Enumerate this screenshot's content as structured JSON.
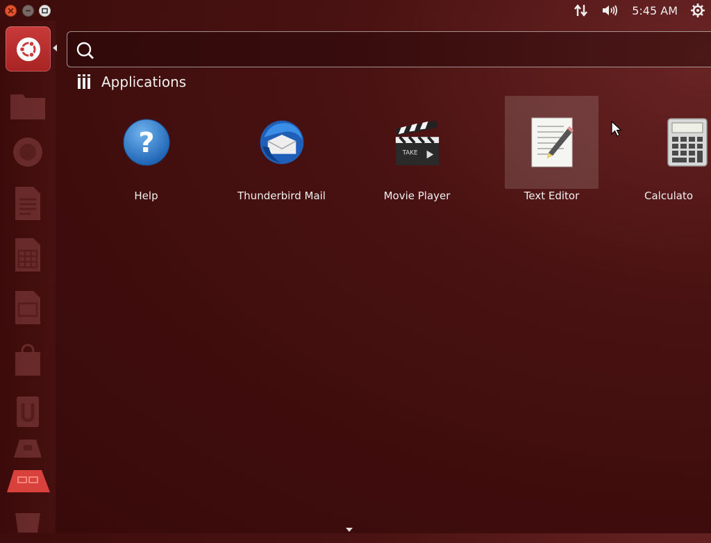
{
  "window_controls": {
    "close": "close-icon",
    "minimize": "minimize-icon",
    "maximize": "maximize-icon"
  },
  "top_panel": {
    "clock": "5:45 AM",
    "network_icon": "network-arrows-icon",
    "volume_icon": "volume-icon",
    "settings_icon": "gear-icon"
  },
  "search": {
    "value": "",
    "placeholder": ""
  },
  "section": {
    "title": "Applications",
    "icon": "applications-lens-icon"
  },
  "apps": [
    {
      "label": "Help",
      "icon": "help-icon"
    },
    {
      "label": "Thunderbird Mail",
      "icon": "thunderbird-icon"
    },
    {
      "label": "Movie Player",
      "icon": "movie-player-icon"
    },
    {
      "label": "Text Editor",
      "icon": "text-editor-icon",
      "selected": true
    },
    {
      "label": "Calculato",
      "icon": "calculator-icon"
    }
  ],
  "launcher": {
    "items": [
      "home-icon",
      "files-icon",
      "firefox-icon",
      "writer-icon",
      "calc-icon",
      "impress-icon",
      "software-center-icon",
      "ubuntu-one-icon",
      "settings-icon",
      "workspaces-icon",
      "trash-icon"
    ]
  },
  "colors": {
    "background": "#3e0c0c",
    "home_button": "#c93a3a",
    "close_button": "#e2542d",
    "help_blue": "#2f80d0"
  }
}
